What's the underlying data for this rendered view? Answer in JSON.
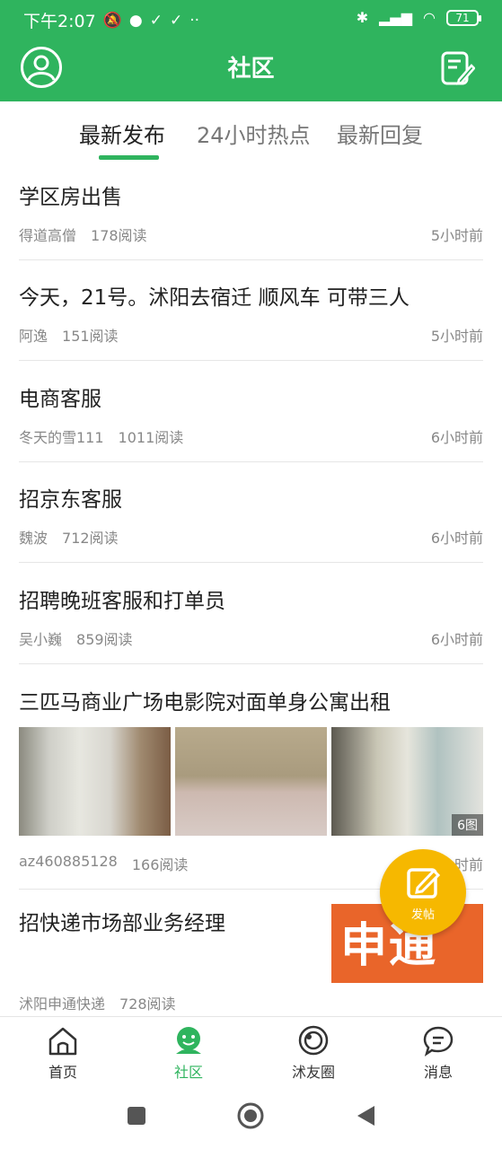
{
  "status_bar": {
    "time": "下午2:07",
    "battery": "71"
  },
  "app_bar": {
    "title": "社区"
  },
  "tabs": [
    {
      "label": "最新发布",
      "active": true
    },
    {
      "label": "24小时热点",
      "active": false
    },
    {
      "label": "最新回复",
      "active": false
    }
  ],
  "posts": [
    {
      "title": "学区房出售",
      "author": "得道高僧",
      "reads": "178阅读",
      "time": "5小时前"
    },
    {
      "title": "今天，21号。沭阳去宿迁 顺风车 可带三人",
      "author": "阿逸",
      "reads": "151阅读",
      "time": "5小时前"
    },
    {
      "title": "电商客服",
      "author": "冬天的雪111",
      "reads": "1011阅读",
      "time": "6小时前"
    },
    {
      "title": "招京东客服",
      "author": "魏波",
      "reads": "712阅读",
      "time": "6小时前"
    },
    {
      "title": "招聘晚班客服和打单员",
      "author": "吴小巍",
      "reads": "859阅读",
      "time": "6小时前"
    },
    {
      "title": "三匹马商业广场电影院对面单身公寓出租",
      "author": "az460885128",
      "reads": "166阅读",
      "time": "6小时前",
      "image_count": "6图"
    },
    {
      "title": "招快递市场部业务经理",
      "author": "沭阳申通快递",
      "reads": "728阅读",
      "thumb_text": "申通"
    }
  ],
  "fab": {
    "label": "发帖"
  },
  "bottom_nav": [
    {
      "label": "首页",
      "icon": "home-icon",
      "active": false
    },
    {
      "label": "社区",
      "icon": "community-icon",
      "active": true
    },
    {
      "label": "沭友圈",
      "icon": "moments-icon",
      "active": false
    },
    {
      "label": "消息",
      "icon": "message-icon",
      "active": false
    }
  ],
  "colors": {
    "brand_green": "#2fb45e",
    "fab_yellow": "#f6b800"
  }
}
